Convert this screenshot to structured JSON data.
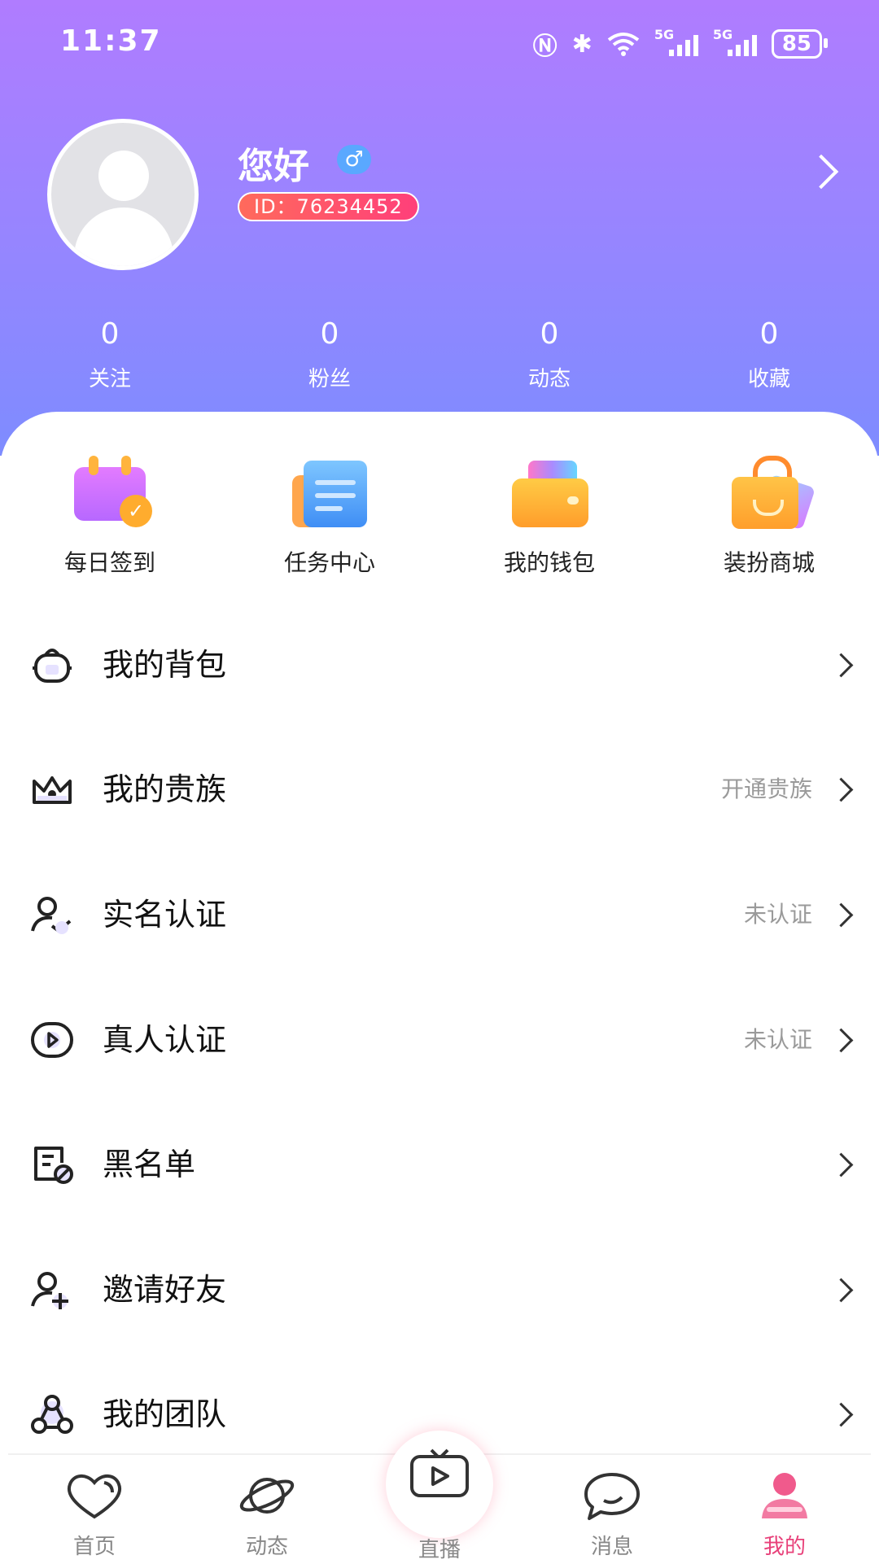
{
  "status_bar": {
    "time": "11:37",
    "network": "5G",
    "battery": "85"
  },
  "profile": {
    "nickname": "您好",
    "gender_symbol": "♂",
    "id_text": "ID：76234452"
  },
  "stats": [
    {
      "value": "0",
      "label": "关注"
    },
    {
      "value": "0",
      "label": "粉丝"
    },
    {
      "value": "0",
      "label": "动态"
    },
    {
      "value": "0",
      "label": "收藏"
    }
  ],
  "quick_actions": [
    {
      "label": "每日签到",
      "icon": "calendar-check-icon"
    },
    {
      "label": "任务中心",
      "icon": "task-document-icon"
    },
    {
      "label": "我的钱包",
      "icon": "wallet-icon"
    },
    {
      "label": "装扮商城",
      "icon": "shopping-bag-icon"
    }
  ],
  "menu": [
    {
      "label": "我的背包",
      "hint": "",
      "icon": "backpack-icon"
    },
    {
      "label": "我的贵族",
      "hint": "开通贵族",
      "icon": "crown-icon"
    },
    {
      "label": "实名认证",
      "hint": "未认证",
      "icon": "user-verify-icon"
    },
    {
      "label": "真人认证",
      "hint": "未认证",
      "icon": "play-verify-icon"
    },
    {
      "label": "黑名单",
      "hint": "",
      "icon": "blacklist-icon"
    },
    {
      "label": "邀请好友",
      "hint": "",
      "icon": "invite-user-icon"
    },
    {
      "label": "我的团队",
      "hint": "",
      "icon": "team-icon"
    }
  ],
  "tabs": [
    {
      "label": "首页",
      "icon": "heart-icon",
      "active": false
    },
    {
      "label": "动态",
      "icon": "planet-icon",
      "active": false
    },
    {
      "label": "直播",
      "icon": "tv-play-icon",
      "active": false
    },
    {
      "label": "消息",
      "icon": "chat-bubble-icon",
      "active": false
    },
    {
      "label": "我的",
      "icon": "person-icon",
      "active": true
    }
  ],
  "colors": {
    "header_top": "#b07cff",
    "header_bottom": "#7e8cff",
    "accent": "#e8417a",
    "id_pill": "#ff4f6e"
  }
}
